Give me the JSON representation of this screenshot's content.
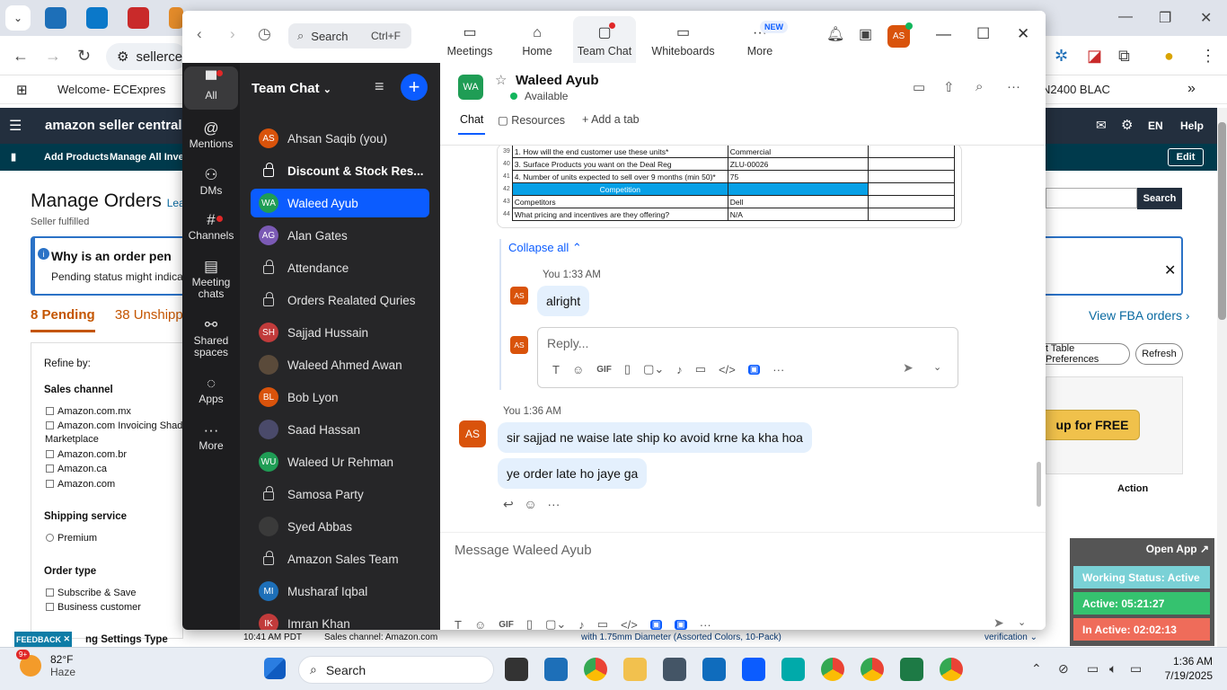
{
  "browser": {
    "url_text": "sellerce",
    "bookmark_label": "Welcome- ECExpres",
    "right_bookmark": "N2400 BLAC"
  },
  "amazon": {
    "brand": "amazon seller central",
    "lang": "EN",
    "help": "Help",
    "nav": [
      "Add Products",
      "Manage All Invent"
    ],
    "edit": "Edit",
    "title": "Manage Orders",
    "title_link": "Lear",
    "subtitle": "Seller fulfilled",
    "alert_heading": "Why is an order pen",
    "alert_text": "Pending status might indicate",
    "tab_pending": "8 Pending",
    "tab_unshipped": "38 Unshipped",
    "refine_title": "Refine by:",
    "sales_channel_title": "Sales channel",
    "sales_channels": [
      "Amazon.com.mx",
      "Amazon.com Invoicing Shado",
      "Marketplace",
      "Amazon.com.br",
      "Amazon.ca",
      "Amazon.com"
    ],
    "shipping_title": "Shipping service",
    "shipping_opt": "Premium",
    "order_type_title": "Order type",
    "order_types": [
      "Subscribe & Save",
      "Business customer"
    ],
    "settings_type": "ng Settings Type",
    "feedback": "FEEDBACK",
    "search_btn": "Search",
    "view_fba": "View FBA orders",
    "table_prefs": "t Table Preferences",
    "refresh": "Refresh",
    "promo": "up for FREE",
    "action_col": "Action",
    "footer_time": "10:41 AM PDT",
    "footer_channel": "Sales channel: Amazon.com",
    "footer_product": "with 1.75mm Diameter (Assorted Colors, 10-Pack)",
    "footer_verification": "verification"
  },
  "zoom": {
    "search_placeholder": "Search",
    "search_shortcut": "Ctrl+F",
    "tabs": [
      "Meetings",
      "Home",
      "Team Chat",
      "Whiteboards",
      "More"
    ],
    "new_badge": "NEW",
    "user_initials": "AS",
    "rail": [
      "All",
      "Mentions",
      "DMs",
      "Channels",
      "Meeting chats",
      "Shared spaces",
      "Apps",
      "More"
    ],
    "list_title": "Team Chat",
    "chats": [
      {
        "name": "Ahsan Saqib (you)",
        "initials": "AS",
        "color": "#d9530b",
        "kind": "avatar"
      },
      {
        "name": "Discount & Stock Res...",
        "kind": "lock",
        "bold": true
      },
      {
        "name": "Waleed Ayub",
        "initials": "WA",
        "color": "#1f9d55",
        "kind": "avatar",
        "selected": true
      },
      {
        "name": "Alan Gates",
        "initials": "AG",
        "color": "#7b5ab5",
        "kind": "avatar"
      },
      {
        "name": "Attendance",
        "kind": "lock"
      },
      {
        "name": "Orders Realated Quries",
        "kind": "lock"
      },
      {
        "name": "Sajjad Hussain",
        "initials": "SH",
        "color": "#c13b3b",
        "kind": "avatar"
      },
      {
        "name": "Waleed Ahmed Awan",
        "initials": "",
        "color": "#5a4a3a",
        "kind": "avatar"
      },
      {
        "name": "Bob Lyon",
        "initials": "BL",
        "color": "#d9530b",
        "kind": "avatar"
      },
      {
        "name": "Saad Hassan",
        "initials": "",
        "color": "#4a4a6a",
        "kind": "avatar"
      },
      {
        "name": "Waleed Ur Rehman",
        "initials": "WU",
        "color": "#1f9d55",
        "kind": "avatar"
      },
      {
        "name": "Samosa Party",
        "kind": "lock"
      },
      {
        "name": "Syed Abbas",
        "initials": "",
        "color": "#3a3a3a",
        "kind": "avatar"
      },
      {
        "name": "Amazon Sales Team",
        "kind": "lock"
      },
      {
        "name": "Musharaf Iqbal",
        "initials": "MI",
        "color": "#1d6fb8",
        "kind": "avatar"
      },
      {
        "name": "Imran Khan",
        "initials": "IK",
        "color": "#c13b3b",
        "kind": "avatar"
      }
    ],
    "channel": {
      "initials": "WA",
      "name": "Waleed Ayub",
      "status": "Available",
      "tabs": [
        "Chat",
        "Resources",
        "Add a tab"
      ]
    },
    "sheet_rows": [
      {
        "n": "39",
        "q": "1. How will the end customer use these units*",
        "a": "Commercial"
      },
      {
        "n": "40",
        "q": "3. Surface Products you want on the Deal Reg",
        "a": "ZLU-00026"
      },
      {
        "n": "41",
        "q": "4. Number of units expected to sell over 9 months (min 50)*",
        "a": "75"
      },
      {
        "n": "42",
        "q": "Competition",
        "a": ""
      },
      {
        "n": "43",
        "q": "Competitors",
        "a": "Dell"
      },
      {
        "n": "44",
        "q": "What pricing and incentives are they offering?",
        "a": "N/A"
      }
    ],
    "collapse_all": "Collapse all",
    "thread_msg": {
      "author": "You",
      "time": "1:33 AM",
      "text": "alright",
      "initials": "AS"
    },
    "reply_placeholder": "Reply...",
    "messages_meta": {
      "author": "You",
      "time": "1:36 AM",
      "initials": "AS"
    },
    "messages": [
      "sir sajjad ne waise late ship ko avoid krne ka kha hoa",
      "ye order late ho jaye ga"
    ],
    "compose_placeholder": "Message Waleed Ayub"
  },
  "status_widget": {
    "open_app": "Open App",
    "working": "Working Status: Active",
    "active": "Active: 05:21:27",
    "inactive": "In Active: 02:02:13"
  },
  "taskbar": {
    "badge": "9+",
    "temp": "82°F",
    "weather": "Haze",
    "search": "Search",
    "time": "1:36 AM",
    "date": "7/19/2025"
  }
}
